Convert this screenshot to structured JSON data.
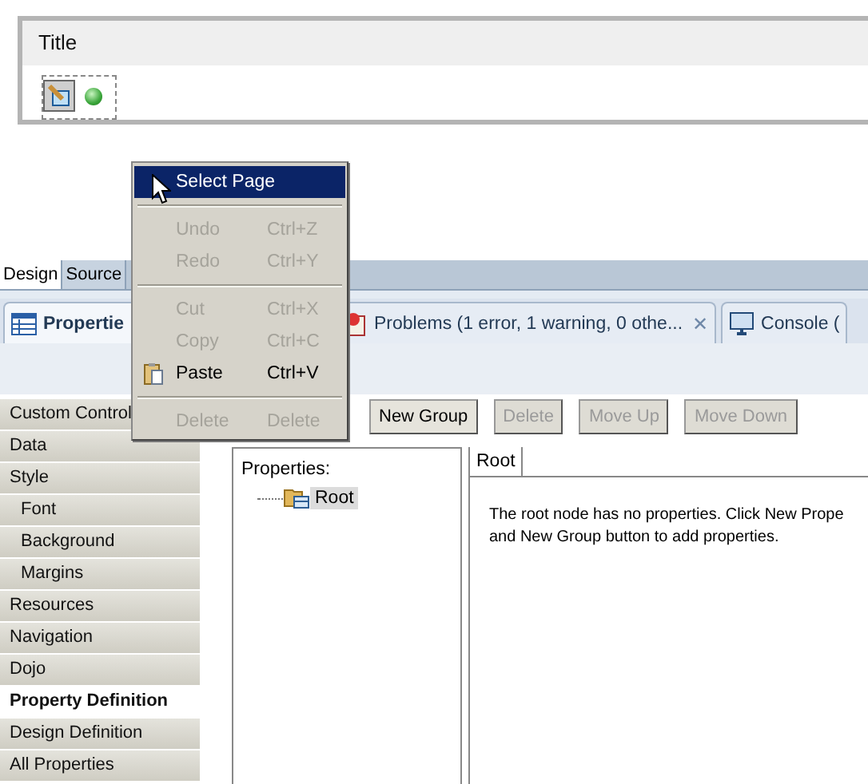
{
  "panel": {
    "title": "Title"
  },
  "editor_tabs": [
    {
      "label": "Design",
      "selected": true
    },
    {
      "label": "Source",
      "selected": false
    }
  ],
  "view_tabs": [
    {
      "label": "Propertie",
      "selected": true,
      "kind": "properties"
    },
    {
      "label": "Problems (1 error, 1 warning, 0 othe...",
      "selected": false,
      "kind": "problems",
      "close": "✕"
    },
    {
      "label": "Console (",
      "selected": false,
      "kind": "console"
    }
  ],
  "sidebar": {
    "items": [
      {
        "label": "Custom Control",
        "selected": false,
        "indented": false
      },
      {
        "label": "Data",
        "selected": false,
        "indented": false
      },
      {
        "label": "Style",
        "selected": false,
        "indented": false
      },
      {
        "label": "Font",
        "selected": false,
        "indented": true
      },
      {
        "label": "Background",
        "selected": false,
        "indented": true
      },
      {
        "label": "Margins",
        "selected": false,
        "indented": true
      },
      {
        "label": "Resources",
        "selected": false,
        "indented": false
      },
      {
        "label": "Navigation",
        "selected": false,
        "indented": false
      },
      {
        "label": "Dojo",
        "selected": false,
        "indented": false
      },
      {
        "label": "Property Definition",
        "selected": true,
        "indented": false
      },
      {
        "label": "Design Definition",
        "selected": false,
        "indented": false
      },
      {
        "label": "All Properties",
        "selected": false,
        "indented": false
      }
    ]
  },
  "toolbar": [
    {
      "label": "New Group",
      "disabled": false
    },
    {
      "label": "Delete",
      "disabled": true
    },
    {
      "label": "Move Up",
      "disabled": true
    },
    {
      "label": "Move Down",
      "disabled": true
    }
  ],
  "tree": {
    "heading": "Properties:",
    "nodes": [
      {
        "label": "Root",
        "selected": true
      }
    ]
  },
  "detail": {
    "tab": "Root",
    "message": "The root node has no properties. Click New Prope\nand New Group button to add properties."
  },
  "context_menu": [
    {
      "kind": "item",
      "label": "Select Page",
      "selected": true,
      "disabled": false
    },
    {
      "kind": "separator"
    },
    {
      "kind": "item",
      "label": "Undo",
      "shortcut": "Ctrl+Z",
      "selected": false,
      "disabled": true
    },
    {
      "kind": "item",
      "label": "Redo",
      "shortcut": "Ctrl+Y",
      "selected": false,
      "disabled": true
    },
    {
      "kind": "separator"
    },
    {
      "kind": "item",
      "label": "Cut",
      "shortcut": "Ctrl+X",
      "selected": false,
      "disabled": true
    },
    {
      "kind": "item",
      "label": "Copy",
      "shortcut": "Ctrl+C",
      "selected": false,
      "disabled": true
    },
    {
      "kind": "icon_item",
      "label": "Paste",
      "shortcut": "Ctrl+V",
      "selected": false,
      "disabled": false
    },
    {
      "kind": "separator"
    },
    {
      "kind": "item",
      "label": "Delete",
      "shortcut": "Delete",
      "selected": false,
      "disabled": true
    }
  ]
}
